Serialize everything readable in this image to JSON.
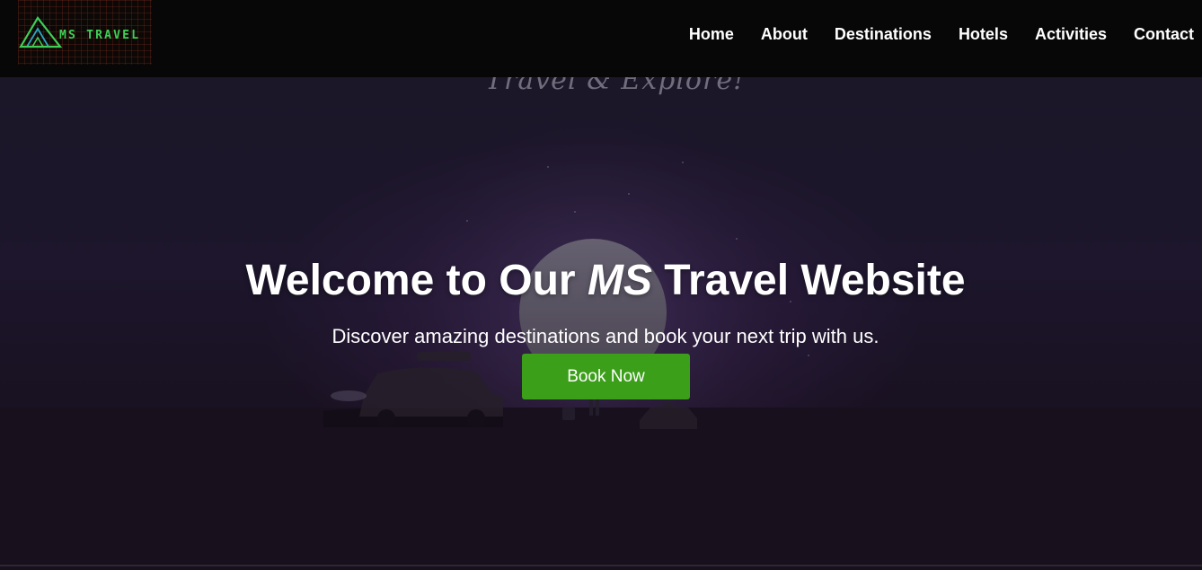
{
  "navbar": {
    "logo_text": "MS TRAVEL",
    "links": [
      "Home",
      "About",
      "Destinations",
      "Hotels",
      "Activities",
      "Contact"
    ]
  },
  "hero": {
    "background_script": "Travel & Explore!",
    "title_before": "Welcome to Our ",
    "title_emphasis": "MS",
    "title_after": " Travel Website",
    "subtitle": "Discover amazing destinations and book your next trip with us.",
    "cta_label": "Book Now"
  },
  "colors": {
    "navbar_bg": "#070707",
    "cta_green": "#3c9f1a",
    "logo_green": "#3fcf57",
    "hero_bg": "#1f1a2e"
  }
}
